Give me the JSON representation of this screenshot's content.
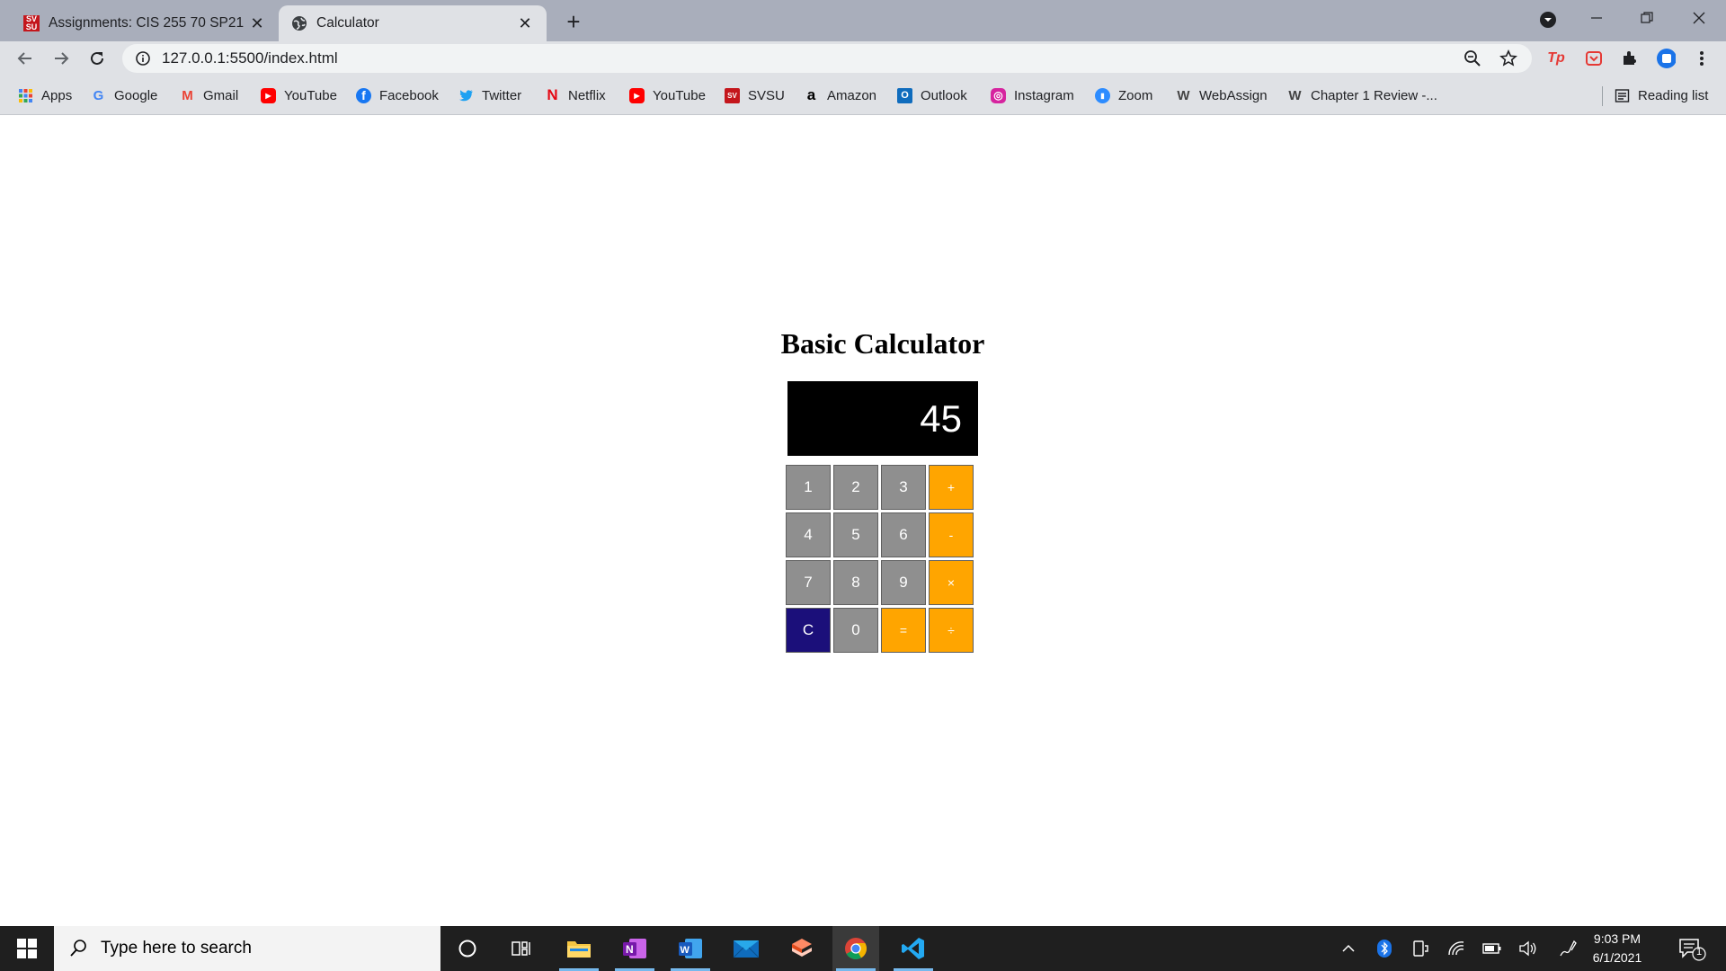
{
  "browser": {
    "tabs": [
      {
        "title": "Assignments: CIS 255 70 SP21",
        "favicon": "svsu-logo",
        "favicon_text": "SV SU",
        "active": false
      },
      {
        "title": "Calculator",
        "favicon": "globe-icon",
        "active": true
      }
    ],
    "address": "127.0.0.1:5500/index.html",
    "bookmarks": [
      {
        "label": "Apps",
        "icon": "apps-grid-icon"
      },
      {
        "label": "Google",
        "icon": "google-icon",
        "glyph": "G",
        "color": "#4285f4"
      },
      {
        "label": "Gmail",
        "icon": "gmail-icon",
        "glyph": "M",
        "color": "#ea4335"
      },
      {
        "label": "YouTube",
        "icon": "youtube-icon",
        "glyph": "▶",
        "color": "#ff0000"
      },
      {
        "label": "Facebook",
        "icon": "facebook-icon",
        "glyph": "f",
        "color": "#1877f2"
      },
      {
        "label": "Twitter",
        "icon": "twitter-icon",
        "glyph": "🐦",
        "color": "#1da1f2"
      },
      {
        "label": "Netflix",
        "icon": "netflix-icon",
        "glyph": "N",
        "color": "#e50914"
      },
      {
        "label": "YouTube",
        "icon": "youtube-icon",
        "glyph": "▶",
        "color": "#ff0000"
      },
      {
        "label": "SVSU",
        "icon": "svsu-logo",
        "glyph": "SV",
        "color": "#c4161c"
      },
      {
        "label": "Amazon",
        "icon": "amazon-icon",
        "glyph": "a",
        "color": "#000000"
      },
      {
        "label": "Outlook",
        "icon": "outlook-icon",
        "glyph": "O",
        "color": "#0f6cbd"
      },
      {
        "label": "Instagram",
        "icon": "instagram-icon",
        "glyph": "◎",
        "color": "#d6249f"
      },
      {
        "label": "Zoom",
        "icon": "zoom-icon",
        "glyph": "▮",
        "color": "#2d8cff"
      },
      {
        "label": "WebAssign",
        "icon": "webassign-icon",
        "glyph": "W",
        "color": "#444444"
      },
      {
        "label": "Chapter 1 Review -...",
        "icon": "webassign-icon",
        "glyph": "W",
        "color": "#444444"
      }
    ],
    "reading_list": "Reading list"
  },
  "calculator": {
    "title": "Basic Calculator",
    "display": "45",
    "keys": [
      {
        "label": "1",
        "type": "digit"
      },
      {
        "label": "2",
        "type": "digit"
      },
      {
        "label": "3",
        "type": "digit"
      },
      {
        "label": "+",
        "type": "operator"
      },
      {
        "label": "4",
        "type": "digit"
      },
      {
        "label": "5",
        "type": "digit"
      },
      {
        "label": "6",
        "type": "digit"
      },
      {
        "label": "-",
        "type": "operator"
      },
      {
        "label": "7",
        "type": "digit"
      },
      {
        "label": "8",
        "type": "digit"
      },
      {
        "label": "9",
        "type": "digit"
      },
      {
        "label": "×",
        "type": "operator"
      },
      {
        "label": "C",
        "type": "clear"
      },
      {
        "label": "0",
        "type": "digit"
      },
      {
        "label": "=",
        "type": "operator"
      },
      {
        "label": "÷",
        "type": "operator"
      }
    ],
    "colors": {
      "digit": "#8f8f8f",
      "operator": "#ffa500",
      "clear": "#1b0f7a",
      "display_bg": "#000000"
    }
  },
  "taskbar": {
    "search_placeholder": "Type here to search",
    "apps": [
      "cortana-icon",
      "task-view-icon",
      "file-explorer-icon",
      "onenote-icon",
      "word-icon",
      "mail-icon",
      "snip-icon",
      "chrome-icon",
      "vscode-icon"
    ],
    "time": "9:03 PM",
    "date": "6/1/2021",
    "notification_count": "1"
  }
}
